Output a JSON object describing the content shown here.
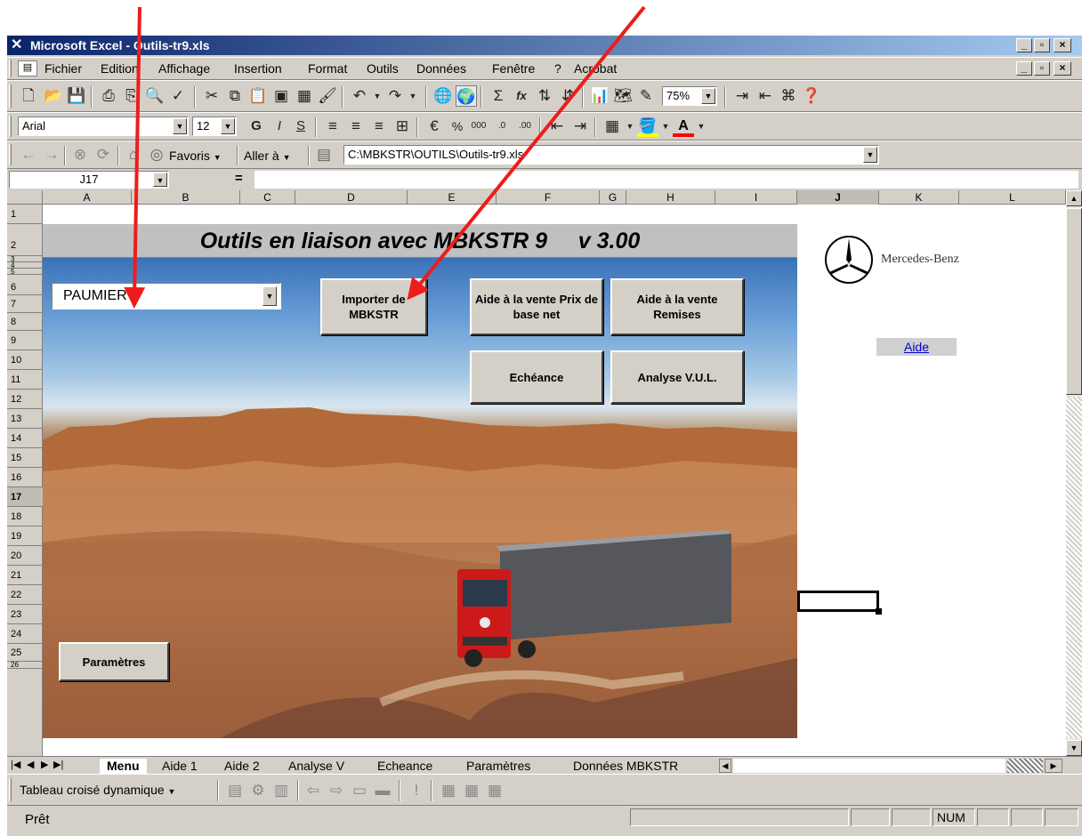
{
  "window": {
    "title": "Microsoft Excel - Outils-tr9.xls",
    "app_icon": "excel-icon",
    "minimize": "_",
    "restore": "▫",
    "close": "×"
  },
  "menu": {
    "items": [
      "Fichier",
      "Edition",
      "Affichage",
      "Insertion",
      "Format",
      "Outils",
      "Données",
      "Fenêtre",
      "?",
      "Acrobat"
    ]
  },
  "toolbar": {
    "zoom": "75%",
    "sum": "Σ",
    "fx": "fx"
  },
  "format": {
    "font": "Arial",
    "size": "12",
    "bold": "G",
    "italic": "I",
    "underline": "S"
  },
  "web": {
    "favoris": "Favoris",
    "aller": "Aller à",
    "address": "C:\\MBKSTR\\OUTILS\\Outils-tr9.xls"
  },
  "formula": {
    "namebox": "J17",
    "equals": "=",
    "value": ""
  },
  "columns": [
    "A",
    "B",
    "C",
    "D",
    "E",
    "F",
    "G",
    "H",
    "I",
    "J",
    "K",
    "L"
  ],
  "rows": [
    "1",
    "2",
    "3",
    "4",
    "5",
    "6",
    "7",
    "8",
    "9",
    "10",
    "11",
    "12",
    "13",
    "14",
    "15",
    "16",
    "17",
    "18",
    "19",
    "20",
    "21",
    "22",
    "23",
    "24",
    "25",
    "26"
  ],
  "sheet": {
    "title": "Outils en liaison avec MBKSTR 9     v 3.00",
    "dropdown_value": "PAUMIER",
    "buttons": {
      "importer": "Importer de MBKSTR",
      "aide_prix": "Aide à la vente Prix de base net",
      "aide_remises": "Aide à la vente Remises",
      "echeance": "Echéance",
      "analyse": "Analyse V.U.L.",
      "parametres": "Paramètres"
    },
    "brand": "Mercedes-Benz",
    "aide_link": "Aide"
  },
  "tabs": [
    "Menu",
    "Aide 1",
    "Aide 2",
    "Analyse V",
    "Echeance",
    "Paramètres",
    "Données MBKSTR"
  ],
  "pivot": {
    "label": "Tableau croisé dynamique"
  },
  "status": {
    "text": "Prêt",
    "num": "NUM"
  },
  "colors": {
    "arrow": "#ee1c1c",
    "titlebar": "#0a246a",
    "link": "#0000cc",
    "truck": "#cc1a1a"
  }
}
